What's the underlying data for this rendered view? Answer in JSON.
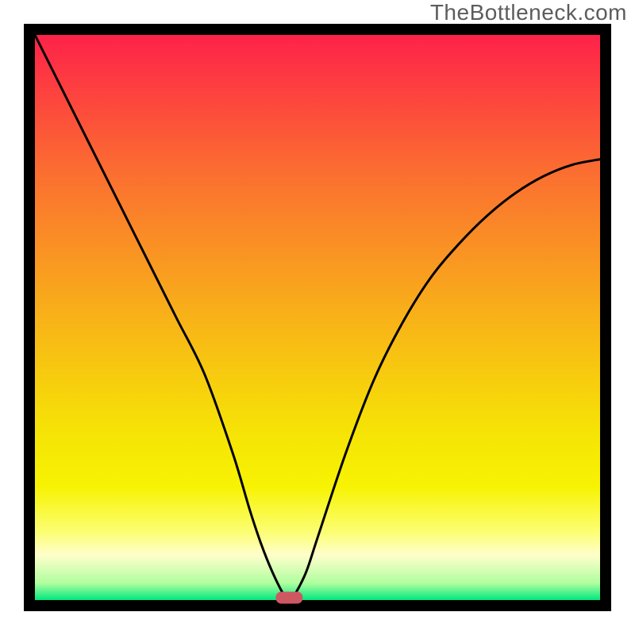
{
  "watermark": "TheBottleneck.com",
  "chart_data": {
    "type": "line",
    "title": "",
    "xlabel": "",
    "ylabel": "",
    "xlim": [
      0,
      100
    ],
    "ylim": [
      0,
      100
    ],
    "series": [
      {
        "name": "bottleneck-curve",
        "x": [
          0,
          5,
          10,
          15,
          20,
          25,
          30,
          35,
          38,
          40,
          42,
          44,
          45,
          46,
          48,
          50,
          55,
          60,
          65,
          70,
          75,
          80,
          85,
          90,
          95,
          100
        ],
        "values": [
          100,
          90,
          80,
          70,
          60,
          50,
          40,
          26,
          16,
          10,
          5,
          1,
          0,
          1,
          5,
          11,
          26,
          39,
          49,
          57,
          63,
          68,
          72,
          75,
          77,
          78
        ]
      }
    ],
    "marker": {
      "x": 45,
      "y": 0,
      "color": "#ce5862"
    },
    "background": {
      "type": "gradient",
      "stops": [
        {
          "offset": 0.0,
          "color": "#fe2249"
        },
        {
          "offset": 0.25,
          "color": "#fb7030"
        },
        {
          "offset": 0.5,
          "color": "#f8b218"
        },
        {
          "offset": 0.7,
          "color": "#f6e306"
        },
        {
          "offset": 0.8,
          "color": "#f7f303"
        },
        {
          "offset": 0.88,
          "color": "#fcfe74"
        },
        {
          "offset": 0.92,
          "color": "#fffecb"
        },
        {
          "offset": 0.97,
          "color": "#b0fe9f"
        },
        {
          "offset": 1.0,
          "color": "#00e77e"
        }
      ]
    }
  }
}
